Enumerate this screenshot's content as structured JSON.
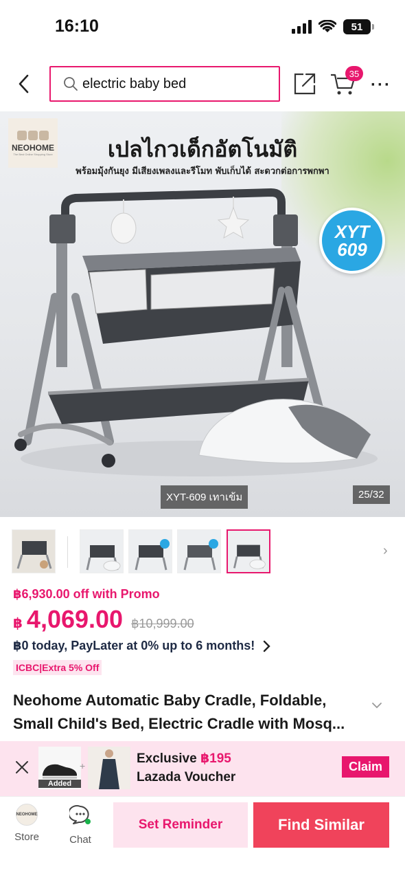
{
  "status": {
    "time": "16:10",
    "battery": "51"
  },
  "header": {
    "search_value": "electric baby bed",
    "cart_count": "35"
  },
  "hero": {
    "brand_name": "NEOHOME",
    "brand_tagline": "The Best Online Shopping Store",
    "title": "เปลไกวเด็กอัตโนมัติ",
    "subtitle": "พร้อมมุ้งกันยุง มีเสียงเพลงและรีโมท พับเก็บได้ สะดวกต่อการพกพา",
    "model_line1": "XYT",
    "model_line2": "609",
    "variant_label": "XYT-609 เทาเข้ม",
    "counter": "25/32"
  },
  "price": {
    "promo": "฿6,930.00 off with Promo",
    "currency": "฿",
    "value": "4,069.00",
    "original": "฿10,999.00",
    "paylater": "฿0 today, PayLater at 0% up to 6 months!",
    "tag": "ICBC|Extra 5% Off"
  },
  "product": {
    "title_line1": "Neohome Automatic Baby Cradle, Foldable,",
    "title_line2": "Small Child's Bed, Electric Cradle with Mosq..."
  },
  "voucher": {
    "added": "Added",
    "prefix": "Exclusive ",
    "amount": "฿195",
    "line2": "Lazada Voucher",
    "claim": "Claim"
  },
  "bottom": {
    "store_logo_text": "NEOHOME",
    "store": "Store",
    "chat": "Chat",
    "reminder": "Set Reminder",
    "similar": "Find Similar"
  },
  "colors": {
    "accent": "#e8176d",
    "find_similar": "#f0435b",
    "reminder_bg": "#fde3ee",
    "badge_blue": "#2aa7e3"
  }
}
